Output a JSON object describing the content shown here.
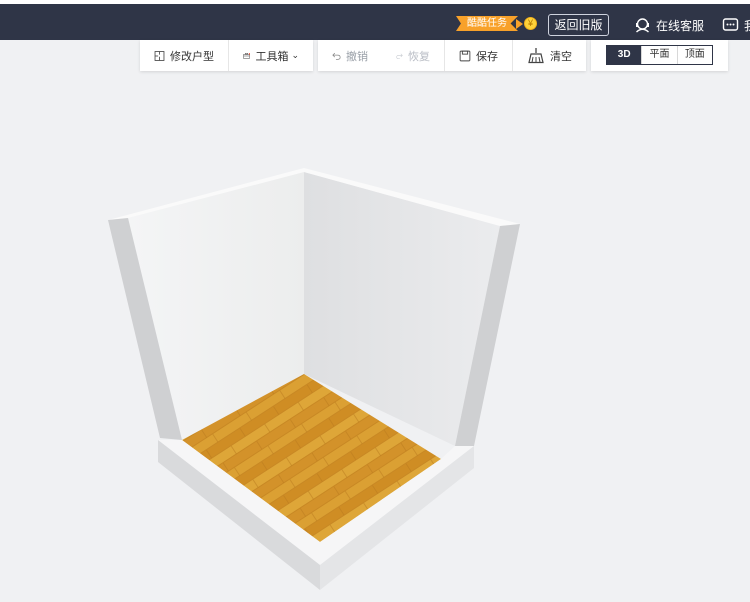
{
  "topbar": {
    "task_badge": "酷酷任务",
    "return_old": "返回旧版",
    "online_service": "在线客服",
    "message_cut": "我"
  },
  "toolbar": {
    "modify_layout": "修改户型",
    "toolbox": "工具箱",
    "undo": "撤销",
    "redo": "恢复",
    "save": "保存",
    "clear": "清空"
  },
  "view": {
    "modes": [
      "3D",
      "平面",
      "顶面"
    ],
    "active": "3D"
  },
  "colors": {
    "topbar": "#2f3547",
    "accent": "#f8a12a",
    "floor": "#d99a2b"
  }
}
